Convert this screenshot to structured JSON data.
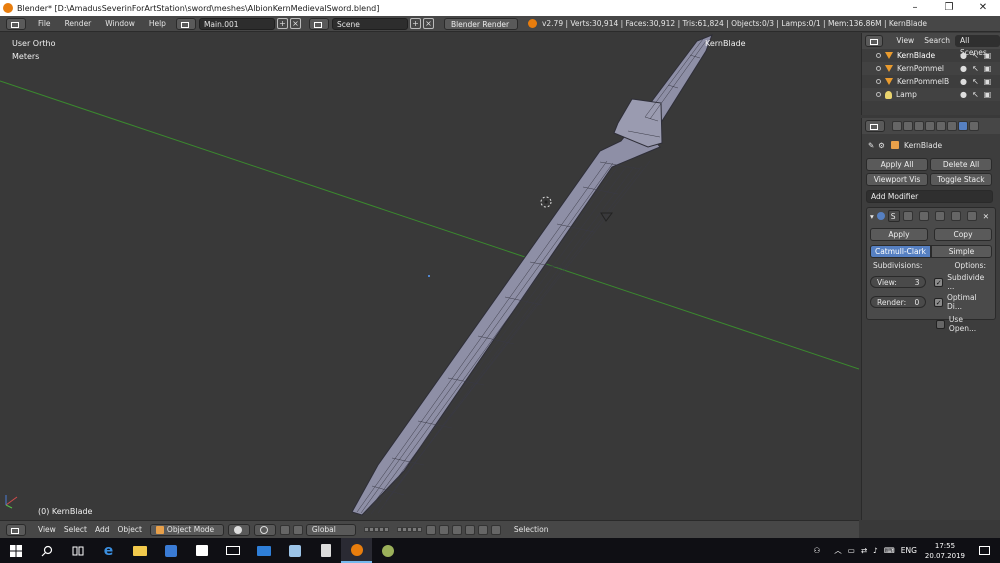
{
  "window": {
    "title": "Blender* [D:\\AmadusSeverinForArtStation\\sword\\meshes\\AlbionKernMedievalSword.blend]",
    "controls": [
      "–",
      "❐",
      "✕"
    ]
  },
  "info_header": {
    "menu": [
      "File",
      "Render",
      "Window",
      "Help"
    ],
    "screen": "Main.001",
    "scene": "Scene",
    "engine": "Blender Render",
    "stats": "v2.79 | Verts:30,914 | Faces:30,912 | Tris:61,824 | Objects:0/3 | Lamps:0/1 | Mem:136.86M | KernBlade"
  },
  "viewport": {
    "view_name": "User Ortho",
    "units": "Meters",
    "object_label": "KernBlade",
    "bottom_label": "(0) KernBlade",
    "colors": {
      "background": "#393939",
      "x_axis": "#3a8a2e",
      "mesh_fill": "#8e8fa6",
      "mesh_edge": "#3a3a46"
    }
  },
  "viewport_footer": {
    "menu": [
      "View",
      "Select",
      "Add",
      "Object"
    ],
    "mode": "Object Mode",
    "orientation": "Global",
    "status": "Selection"
  },
  "outliner": {
    "tabs": [
      "View",
      "Search",
      "All Scenes"
    ],
    "active_tab": "All Scenes",
    "items": [
      {
        "name": "KernBlade",
        "type": "mesh",
        "selected": true
      },
      {
        "name": "KernPommel",
        "type": "mesh",
        "selected": false
      },
      {
        "name": "KernPommelB",
        "type": "mesh",
        "selected": false
      },
      {
        "name": "Lamp",
        "type": "lamp",
        "selected": false
      }
    ]
  },
  "properties": {
    "object_name": "KernBlade",
    "apply_all": "Apply All",
    "delete_all": "Delete All",
    "viewport_vis": "Viewport Vis",
    "toggle_stack": "Toggle Stack",
    "add_modifier": "Add Modifier",
    "modifier_name": "S",
    "apply": "Apply",
    "copy": "Copy",
    "types": [
      "Catmull-Clark",
      "Simple"
    ],
    "active_type": "Catmull-Clark",
    "subdivisions_label": "Subdivisions:",
    "options_label": "Options:",
    "view_label": "View:",
    "view_value": "3",
    "render_label": "Render:",
    "render_value": "0",
    "options": [
      {
        "label": "Subdivide ...",
        "checked": true
      },
      {
        "label": "Optimal Di...",
        "checked": true
      },
      {
        "label": "Use Open...",
        "checked": false
      }
    ]
  },
  "taskbar": {
    "language": "ENG",
    "time": "17:55",
    "date": "20.07.2019"
  }
}
